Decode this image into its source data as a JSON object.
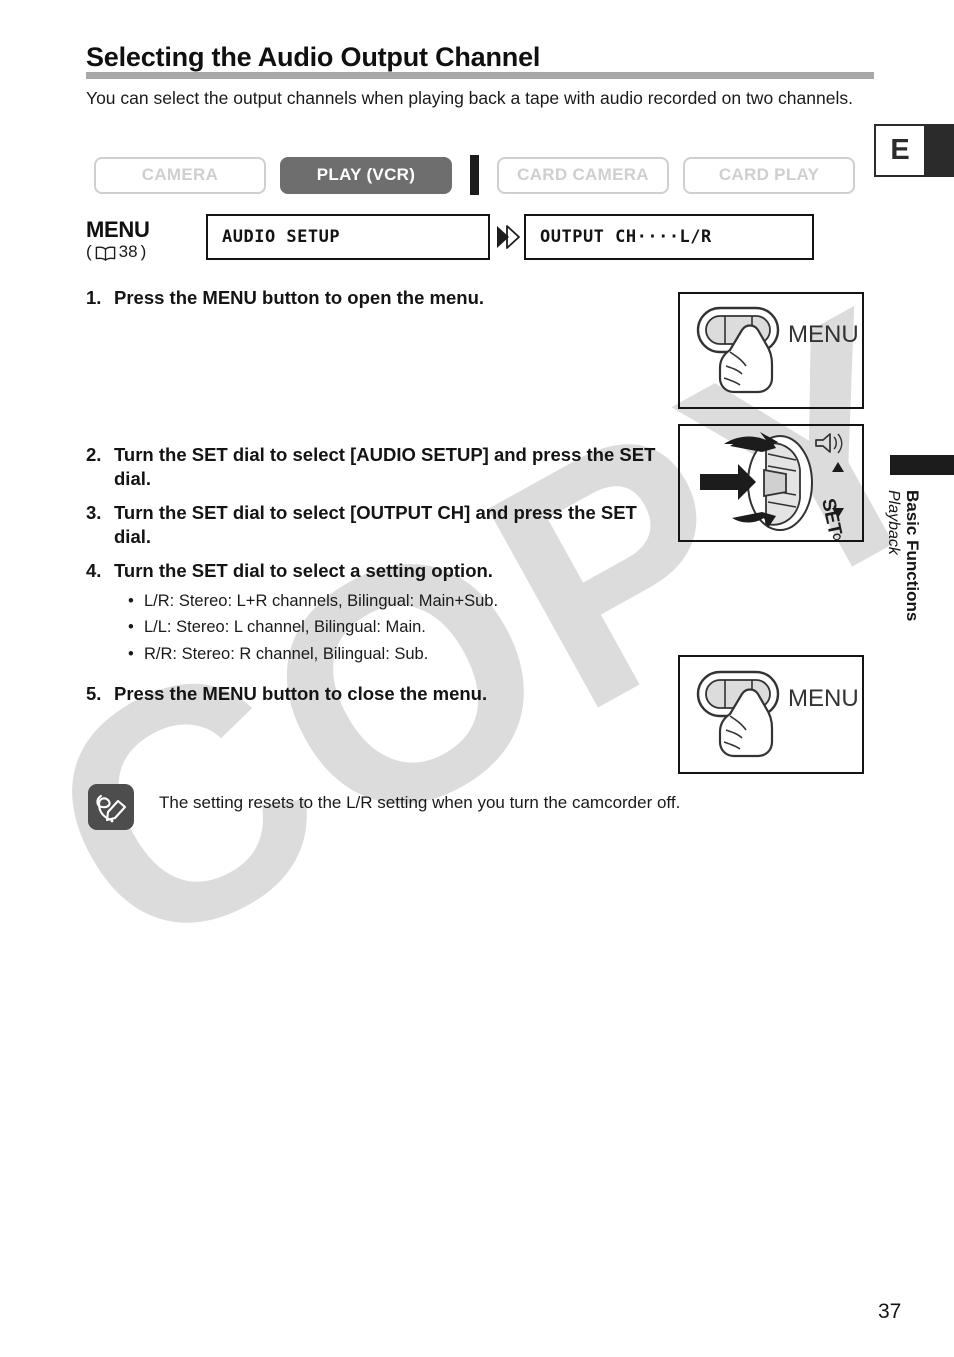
{
  "page": {
    "title": "Selecting the Audio Output Channel",
    "intro": "You can select the output channels when playing back a tape with audio recorded on two channels.",
    "number": "37"
  },
  "mode_bar": {
    "camera": "CAMERA",
    "play_vcr": "PLAY (VCR)",
    "card_camera": "CARD CAMERA",
    "card_play": "CARD PLAY",
    "active_mode": "PLAY (VCR)",
    "active_color": "#6e6e6e",
    "inactive_color": "#cfcfcf"
  },
  "menu_row": {
    "label": "MENU",
    "reference_open": "(",
    "reference_page": "38",
    "reference_close": ")",
    "book_icon": "book-icon",
    "arrow_icon": "double-chevron-right-icon",
    "box_1": "AUDIO SETUP",
    "box_2": "OUTPUT CH····L/R"
  },
  "steps": [
    {
      "num": "1.",
      "text": "Press the MENU button to open the menu."
    },
    {
      "num": "2.",
      "text": "Turn the SET dial to select [AUDIO SETUP] and press the SET dial."
    },
    {
      "num": "3.",
      "text": "Turn the SET dial to select [OUTPUT CH] and press the SET dial."
    },
    {
      "num": "4.",
      "text": "Turn the SET dial to select a setting option."
    },
    {
      "num": "5.",
      "text": "Press the MENU button to close the menu."
    }
  ],
  "options": [
    "L/R: Stereo: L+R channels, Bilingual: Main+Sub.",
    "L/L: Stereo: L channel, Bilingual: Main.",
    "R/R: Stereo: R channel, Bilingual: Sub."
  ],
  "illustrations": {
    "menu_button_top": {
      "label": "MENU",
      "icon": "hand-pressing-menu-button-icon"
    },
    "set_dial": {
      "label": "SET",
      "icons": "set-dial-with-rotation-arrows-icon"
    },
    "menu_button_bottom": {
      "label": "MENU",
      "icon": "hand-pressing-menu-button-icon"
    }
  },
  "note": {
    "icon": "note-pencil-icon",
    "text": "The setting resets to the L/R setting when you turn the camcorder off."
  },
  "margin": {
    "language_tab": "E",
    "chapter": "Basic Functions",
    "section": "Playback"
  },
  "watermark": {
    "text": "COPY",
    "color": "#dcdcdc"
  }
}
